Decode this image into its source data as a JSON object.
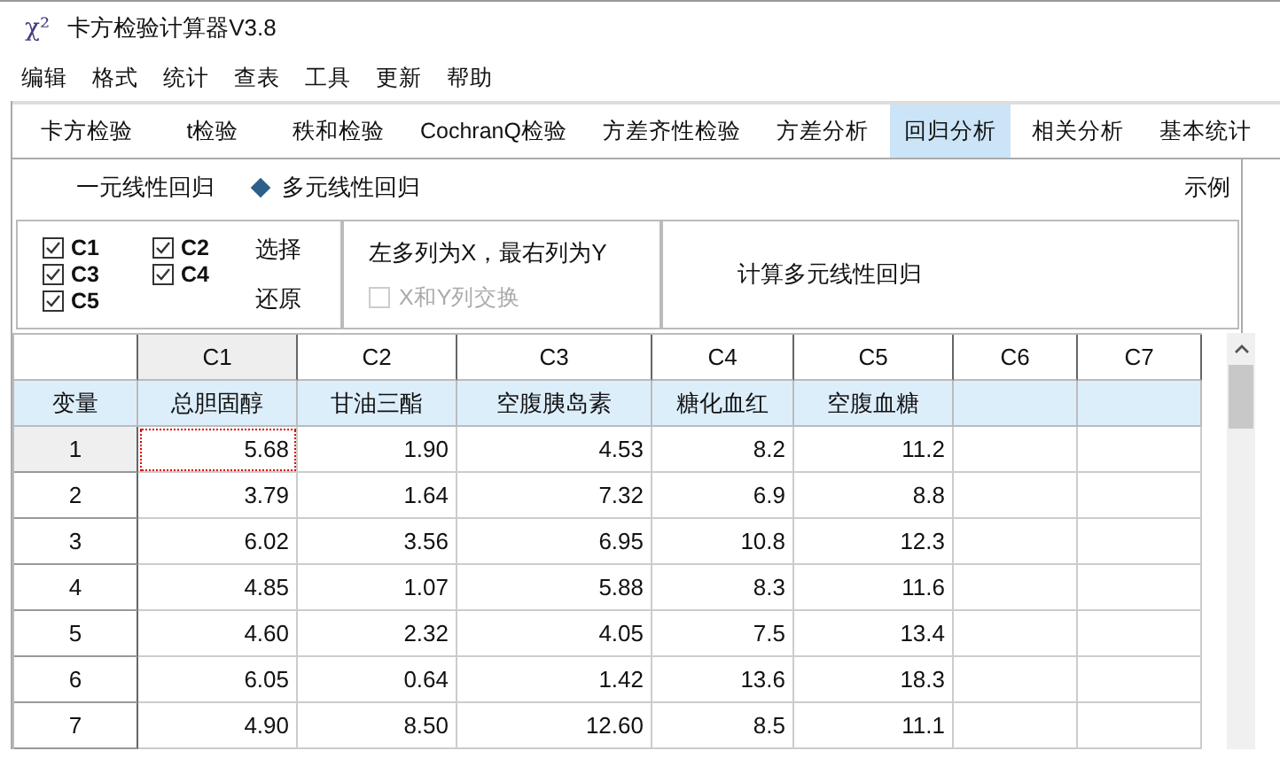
{
  "window": {
    "icon_text": "χ²",
    "title": "卡方检验计算器V3.8"
  },
  "menu": [
    "编辑",
    "格式",
    "统计",
    "查表",
    "工具",
    "更新",
    "帮助"
  ],
  "tabs": [
    {
      "label": "卡方检验",
      "selected": false
    },
    {
      "label": "t检验",
      "selected": false
    },
    {
      "label": "秩和检验",
      "selected": false
    },
    {
      "label": "CochranQ检验",
      "selected": false
    },
    {
      "label": "方差齐性检验",
      "selected": false
    },
    {
      "label": "方差分析",
      "selected": false
    },
    {
      "label": "回归分析",
      "selected": true
    },
    {
      "label": "相关分析",
      "selected": false
    },
    {
      "label": "基本统计",
      "selected": false
    }
  ],
  "modes": [
    {
      "label": "一元线性回归",
      "selected": false
    },
    {
      "label": "多元线性回归",
      "selected": true
    }
  ],
  "example_link": "示例",
  "columns_select": [
    {
      "label": "C1",
      "checked": true
    },
    {
      "label": "C2",
      "checked": true
    },
    {
      "label": "C3",
      "checked": true
    },
    {
      "label": "C4",
      "checked": true
    },
    {
      "label": "C5",
      "checked": true
    }
  ],
  "select_button": "选择",
  "restore_button": "还原",
  "hint": "左多列为X，最右列为Y",
  "swap": {
    "label": "X和Y列交换",
    "checked": false,
    "disabled": true
  },
  "compute_button": "计算多元线性回归",
  "table": {
    "columns": [
      {
        "label": "C1",
        "selected": true
      },
      {
        "label": "C2",
        "selected": false
      },
      {
        "label": "C3",
        "selected": false
      },
      {
        "label": "C4",
        "selected": false
      },
      {
        "label": "C5",
        "selected": false
      },
      {
        "label": "C6",
        "selected": false
      },
      {
        "label": "C7",
        "selected": false
      }
    ],
    "name_row": {
      "label": "变量",
      "names": [
        "总胆固醇",
        "甘油三酯",
        "空腹胰岛素",
        "糖化血红",
        "空腹血糖"
      ]
    },
    "rows": [
      {
        "label": "1",
        "selected": true,
        "cells": [
          "5.68",
          "1.90",
          "4.53",
          "8.2",
          "11.2"
        ]
      },
      {
        "label": "2",
        "selected": false,
        "cells": [
          "3.79",
          "1.64",
          "7.32",
          "6.9",
          "8.8"
        ]
      },
      {
        "label": "3",
        "selected": false,
        "cells": [
          "6.02",
          "3.56",
          "6.95",
          "10.8",
          "12.3"
        ]
      },
      {
        "label": "4",
        "selected": false,
        "cells": [
          "4.85",
          "1.07",
          "5.88",
          "8.3",
          "11.6"
        ]
      },
      {
        "label": "5",
        "selected": false,
        "cells": [
          "4.60",
          "2.32",
          "4.05",
          "7.5",
          "13.4"
        ]
      },
      {
        "label": "6",
        "selected": false,
        "cells": [
          "6.05",
          "0.64",
          "1.42",
          "13.6",
          "18.3"
        ]
      },
      {
        "label": "7",
        "selected": false,
        "cells": [
          "4.90",
          "8.50",
          "12.60",
          "8.5",
          "11.1"
        ]
      }
    ]
  }
}
